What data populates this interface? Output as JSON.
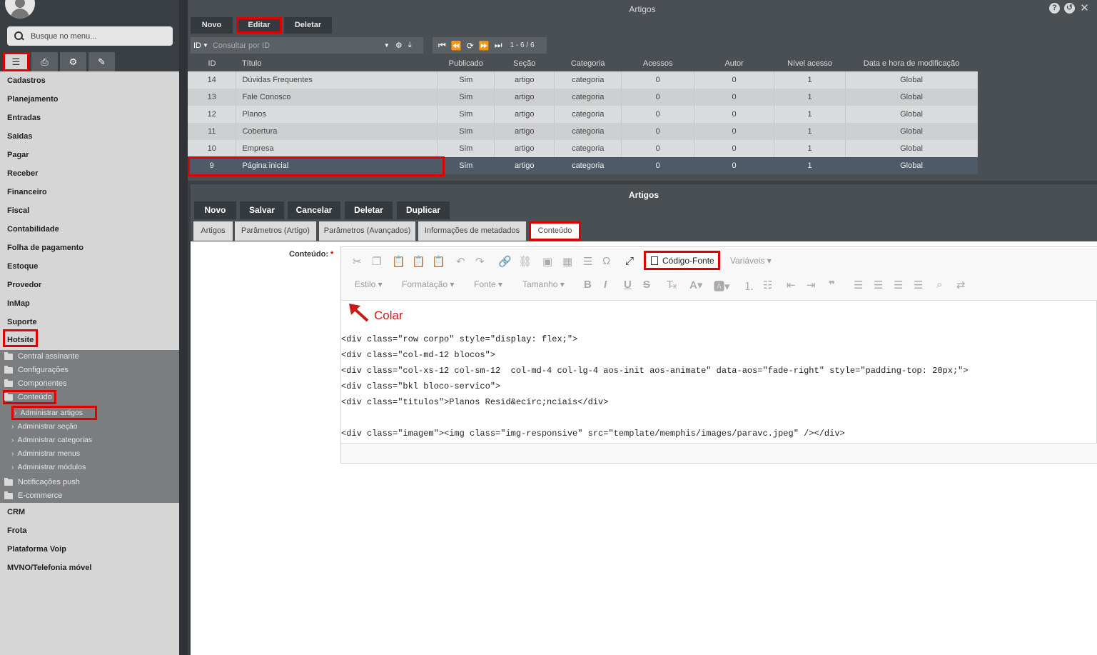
{
  "sidebar": {
    "search_placeholder": "Busque no menu...",
    "menu": [
      "Cadastros",
      "Planejamento",
      "Entradas",
      "Saidas",
      "Pagar",
      "Receber",
      "Financeiro",
      "Fiscal",
      "Contabilidade",
      "Folha de pagamento",
      "Estoque",
      "Provedor",
      "InMap",
      "Suporte",
      "Hotsite"
    ],
    "hotsite_sub": [
      "Central assinante",
      "Configurações",
      "Componentes",
      "Conteúdo"
    ],
    "conteudo_sub": [
      "Administrar artigos",
      "Administrar seção",
      "Administrar categorias",
      "Administrar menus",
      "Administrar módulos"
    ],
    "hotsite_sub2": [
      "Notificações push",
      "E-commerce"
    ],
    "menu2": [
      "CRM",
      "Frota",
      "Plataforma Voip",
      "MVNO/Telefonia móvel"
    ]
  },
  "grid": {
    "title": "Artigos",
    "buttons": {
      "novo": "Novo",
      "editar": "Editar",
      "deletar": "Deletar"
    },
    "filter": {
      "field": "ID",
      "placeholder": "Consultar por ID"
    },
    "pager_info": "1 - 6 / 6",
    "columns": [
      "ID",
      "Título",
      "Publicado",
      "Seção",
      "Categoria",
      "Acessos",
      "Autor",
      "Nível acesso",
      "Data e hora de modificação"
    ],
    "rows": [
      [
        "14",
        "Dúvidas Frequentes",
        "Sim",
        "artigo",
        "categoria",
        "0",
        "0",
        "1",
        "Global"
      ],
      [
        "13",
        "Fale Conosco",
        "Sim",
        "artigo",
        "categoria",
        "0",
        "0",
        "1",
        "Global"
      ],
      [
        "12",
        "Planos",
        "Sim",
        "artigo",
        "categoria",
        "0",
        "0",
        "1",
        "Global"
      ],
      [
        "11",
        "Cobertura",
        "Sim",
        "artigo",
        "categoria",
        "0",
        "0",
        "1",
        "Global"
      ],
      [
        "10",
        "Empresa",
        "Sim",
        "artigo",
        "categoria",
        "0",
        "0",
        "1",
        "Global"
      ],
      [
        "9",
        "Página inicial",
        "Sim",
        "artigo",
        "categoria",
        "0",
        "0",
        "1",
        "Global"
      ]
    ]
  },
  "form": {
    "title": "Artigos",
    "buttons": {
      "novo": "Novo",
      "salvar": "Salvar",
      "cancelar": "Cancelar",
      "deletar": "Deletar",
      "duplicar": "Duplicar"
    },
    "tabs": [
      "Artigos",
      "Parâmetros (Artigo)",
      "Parâmetros (Avançados)",
      "Informações de metadados",
      "Conteúdo"
    ],
    "content_label": "Conteúdo:",
    "required_mark": "*",
    "editor": {
      "source_button": "Código-Fonte",
      "variables": "Variáveis",
      "style": "Estilo",
      "format": "Formatação",
      "font": "Fonte",
      "size": "Tamanho",
      "annotation": "Colar",
      "code_lines": [
        "<div class=\"row corpo\" style=\"display: flex;\">",
        "<div class=\"col-md-12 blocos\">",
        "<div class=\"col-xs-12 col-sm-12  col-md-4 col-lg-4 aos-init aos-animate\" data-aos=\"fade-right\" style=\"padding-top: 20px;\">",
        "<div class=\"bkl bloco-servico\">",
        "<div class=\"titulos\">Planos Resid&ecirc;nciais</div>",
        "",
        "<div class=\"imagem\"><img class=\"img-responsive\" src=\"template/memphis/images/paravc.jpeg\" /></div>"
      ]
    }
  }
}
